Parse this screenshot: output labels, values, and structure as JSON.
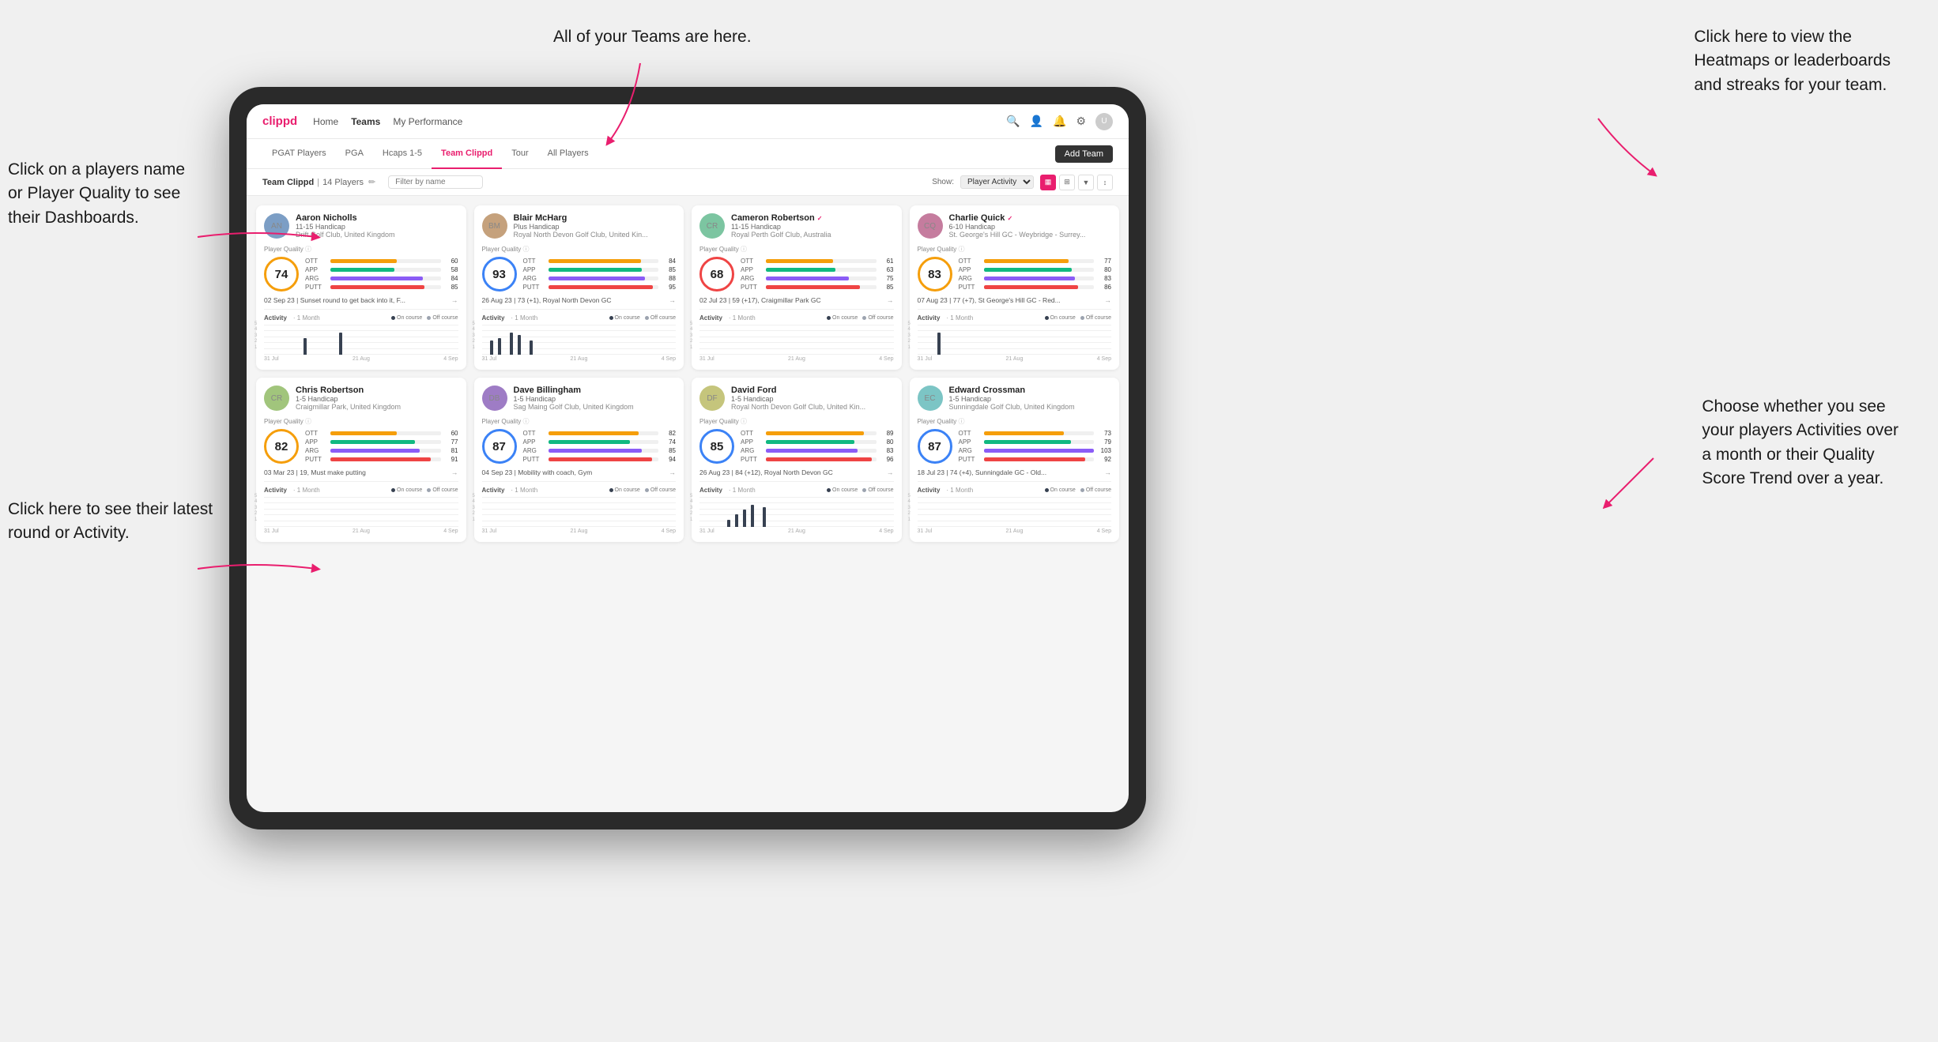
{
  "annotations": {
    "teams_tooltip": "All of your Teams are here.",
    "heatmaps_tooltip": "Click here to view the\nHeatmaps or leaderboards\nand streaks for your team.",
    "players_name_tooltip": "Click on a players name\nor Player Quality to see\ntheir Dashboards.",
    "activities_tooltip": "Choose whether you see\nyour players Activities over\na month or their Quality\nScore Trend over a year.",
    "latest_round_tooltip": "Click here to see their latest\nround or Activity."
  },
  "nav": {
    "logo": "clippd",
    "links": [
      "Home",
      "Teams",
      "My Performance"
    ],
    "active_link": "Teams"
  },
  "sub_tabs": {
    "tabs": [
      "PGAT Players",
      "PGA",
      "Hcaps 1-5",
      "Team Clippd",
      "Tour",
      "All Players"
    ],
    "active": "Team Clippd",
    "add_team_label": "Add Team"
  },
  "team_header": {
    "title": "Team Clippd",
    "separator": "|",
    "count": "14 Players",
    "search_placeholder": "Filter by name",
    "show_label": "Show:",
    "show_option": "Player Activity",
    "view_options": [
      "grid-2",
      "grid-3",
      "filter",
      "sort"
    ]
  },
  "players": [
    {
      "name": "Aaron Nicholls",
      "handicap": "11-15 Handicap",
      "club": "Drift Golf Club, United Kingdom",
      "quality": 74,
      "quality_level": "medium",
      "stats": {
        "ott": {
          "label": "OTT",
          "value": 60,
          "pct": 60
        },
        "app": {
          "label": "APP",
          "value": 58,
          "pct": 58
        },
        "arg": {
          "label": "ARG",
          "value": 84,
          "pct": 84
        },
        "putt": {
          "label": "PUTT",
          "value": 85,
          "pct": 85
        }
      },
      "latest_round": "02 Sep 23 | Sunset round to get back into it, F...",
      "activity_bars": [
        0,
        0,
        0,
        0,
        0,
        0,
        0,
        0,
        0,
        0,
        3,
        0,
        0,
        0,
        0,
        0,
        0,
        0,
        0,
        4,
        0
      ],
      "chart_dates": [
        "31 Jul",
        "21 Aug",
        "4 Sep"
      ]
    },
    {
      "name": "Blair McHarg",
      "handicap": "Plus Handicap",
      "club": "Royal North Devon Golf Club, United Kin...",
      "quality": 93,
      "quality_level": "high",
      "stats": {
        "ott": {
          "label": "OTT",
          "value": 84,
          "pct": 84
        },
        "app": {
          "label": "APP",
          "value": 85,
          "pct": 85
        },
        "arg": {
          "label": "ARG",
          "value": 88,
          "pct": 88
        },
        "putt": {
          "label": "PUTT",
          "value": 95,
          "pct": 95
        }
      },
      "latest_round": "26 Aug 23 | 73 (+1), Royal North Devon GC",
      "activity_bars": [
        0,
        0,
        5,
        0,
        6,
        0,
        0,
        8,
        0,
        7,
        0,
        0,
        5,
        0,
        0,
        0,
        0,
        0,
        0,
        0,
        0
      ],
      "chart_dates": [
        "31 Jul",
        "21 Aug",
        "4 Sep"
      ]
    },
    {
      "name": "Cameron Robertson",
      "handicap": "11-15 Handicap",
      "club": "Royal Perth Golf Club, Australia",
      "quality": 68,
      "quality_level": "medium",
      "stats": {
        "ott": {
          "label": "OTT",
          "value": 61,
          "pct": 61
        },
        "app": {
          "label": "APP",
          "value": 63,
          "pct": 63
        },
        "arg": {
          "label": "ARG",
          "value": 75,
          "pct": 75
        },
        "putt": {
          "label": "PUTT",
          "value": 85,
          "pct": 85
        }
      },
      "latest_round": "02 Jul 23 | 59 (+17), Craigmillar Park GC",
      "activity_bars": [
        0,
        0,
        0,
        0,
        0,
        0,
        0,
        0,
        0,
        0,
        0,
        0,
        0,
        0,
        0,
        0,
        0,
        0,
        0,
        0,
        0
      ],
      "chart_dates": [
        "31 Jul",
        "21 Aug",
        "4 Sep"
      ]
    },
    {
      "name": "Charlie Quick",
      "handicap": "6-10 Handicap",
      "club": "St. George's Hill GC - Weybridge - Surrey...",
      "quality": 83,
      "quality_level": "high",
      "stats": {
        "ott": {
          "label": "OTT",
          "value": 77,
          "pct": 77
        },
        "app": {
          "label": "APP",
          "value": 80,
          "pct": 80
        },
        "arg": {
          "label": "ARG",
          "value": 83,
          "pct": 83
        },
        "putt": {
          "label": "PUTT",
          "value": 86,
          "pct": 86
        }
      },
      "latest_round": "07 Aug 23 | 77 (+7), St George's Hill GC - Red...",
      "activity_bars": [
        0,
        0,
        0,
        0,
        0,
        4,
        0,
        0,
        0,
        0,
        0,
        0,
        0,
        0,
        0,
        0,
        0,
        0,
        0,
        0,
        0
      ],
      "chart_dates": [
        "31 Jul",
        "21 Aug",
        "4 Sep"
      ]
    },
    {
      "name": "Chris Robertson",
      "handicap": "1-5 Handicap",
      "club": "Craigmillar Park, United Kingdom",
      "quality": 82,
      "quality_level": "high",
      "stats": {
        "ott": {
          "label": "OTT",
          "value": 60,
          "pct": 60
        },
        "app": {
          "label": "APP",
          "value": 77,
          "pct": 77
        },
        "arg": {
          "label": "ARG",
          "value": 81,
          "pct": 81
        },
        "putt": {
          "label": "PUTT",
          "value": 91,
          "pct": 91
        }
      },
      "latest_round": "03 Mar 23 | 19, Must make putting",
      "activity_bars": [
        0,
        0,
        0,
        0,
        0,
        0,
        0,
        0,
        0,
        0,
        0,
        0,
        0,
        0,
        0,
        0,
        0,
        0,
        0,
        0,
        0
      ],
      "chart_dates": [
        "31 Jul",
        "21 Aug",
        "4 Sep"
      ]
    },
    {
      "name": "Dave Billingham",
      "handicap": "1-5 Handicap",
      "club": "Sag Maing Golf Club, United Kingdom",
      "quality": 87,
      "quality_level": "high",
      "stats": {
        "ott": {
          "label": "OTT",
          "value": 82,
          "pct": 82
        },
        "app": {
          "label": "APP",
          "value": 74,
          "pct": 74
        },
        "arg": {
          "label": "ARG",
          "value": 85,
          "pct": 85
        },
        "putt": {
          "label": "PUTT",
          "value": 94,
          "pct": 94
        }
      },
      "latest_round": "04 Sep 23 | Mobility with coach, Gym",
      "activity_bars": [
        0,
        0,
        0,
        0,
        0,
        0,
        0,
        0,
        0,
        0,
        0,
        0,
        0,
        0,
        0,
        0,
        0,
        0,
        0,
        0,
        0
      ],
      "chart_dates": [
        "31 Jul",
        "21 Aug",
        "4 Sep"
      ]
    },
    {
      "name": "David Ford",
      "handicap": "1-5 Handicap",
      "club": "Royal North Devon Golf Club, United Kin...",
      "quality": 85,
      "quality_level": "high",
      "stats": {
        "ott": {
          "label": "OTT",
          "value": 89,
          "pct": 89
        },
        "app": {
          "label": "APP",
          "value": 80,
          "pct": 80
        },
        "arg": {
          "label": "ARG",
          "value": 83,
          "pct": 83
        },
        "putt": {
          "label": "PUTT",
          "value": 96,
          "pct": 96
        }
      },
      "latest_round": "26 Aug 23 | 84 (+12), Royal North Devon GC",
      "activity_bars": [
        0,
        0,
        0,
        0,
        0,
        0,
        0,
        3,
        0,
        5,
        0,
        7,
        0,
        9,
        0,
        0,
        8,
        0,
        0,
        0,
        0
      ],
      "chart_dates": [
        "31 Jul",
        "21 Aug",
        "4 Sep"
      ]
    },
    {
      "name": "Edward Crossman",
      "handicap": "1-5 Handicap",
      "club": "Sunningdale Golf Club, United Kingdom",
      "quality": 87,
      "quality_level": "high",
      "stats": {
        "ott": {
          "label": "OTT",
          "value": 73,
          "pct": 73
        },
        "app": {
          "label": "APP",
          "value": 79,
          "pct": 79
        },
        "arg": {
          "label": "ARG",
          "value": 103,
          "pct": 100
        },
        "putt": {
          "label": "PUTT",
          "value": 92,
          "pct": 92
        }
      },
      "latest_round": "18 Jul 23 | 74 (+4), Sunningdale GC - Old...",
      "activity_bars": [
        0,
        0,
        0,
        0,
        0,
        0,
        0,
        0,
        0,
        0,
        0,
        0,
        0,
        0,
        0,
        0,
        0,
        0,
        0,
        0,
        0
      ],
      "chart_dates": [
        "31 Jul",
        "21 Aug",
        "4 Sep"
      ]
    }
  ]
}
